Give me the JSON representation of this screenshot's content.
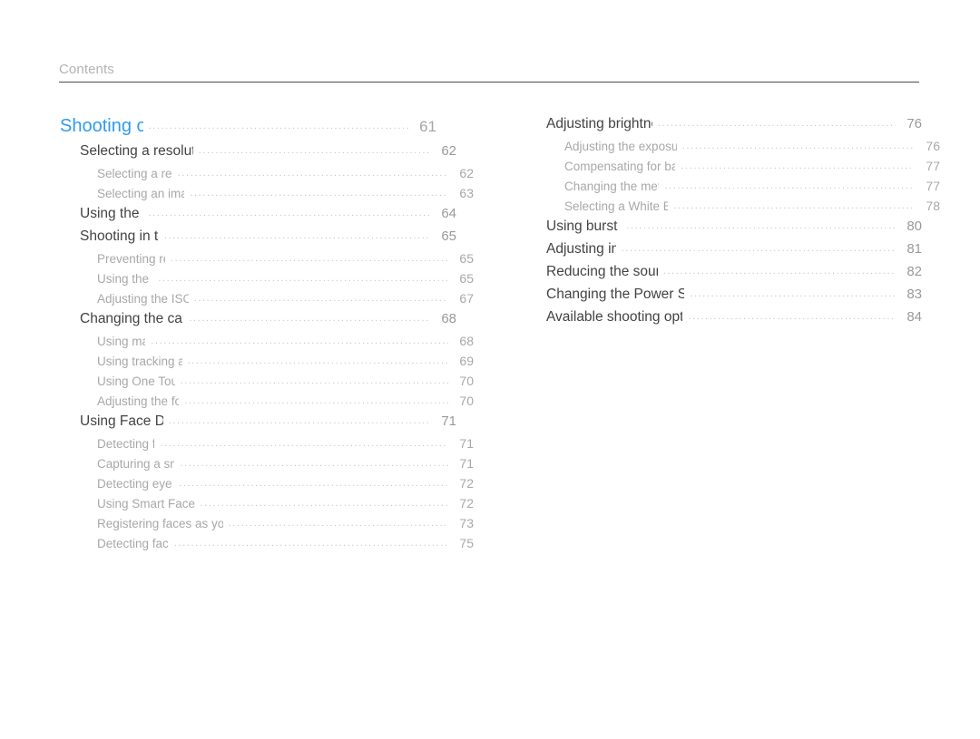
{
  "header": {
    "title": "Contents"
  },
  "colors": {
    "chapter_blue": "#2e9bef",
    "section_dark": "#434343",
    "subsection_gray": "#a8a8a8",
    "page_number_gray": "#a6a6a6",
    "header_gray": "#b3b3b3",
    "rule_dark": "#4d4d4d",
    "dots_gray": "#c6c6c6",
    "background": "#ffffff"
  },
  "dots": "....................................................................................................",
  "columns": {
    "left": {
      "entries": [
        {
          "level": 1,
          "label": "Shooting options",
          "page": "61"
        },
        {
          "level": 2,
          "label": "Selecting a resolution and quality",
          "page": "62"
        },
        {
          "level": 3,
          "label": "Selecting a resolution",
          "page": "62"
        },
        {
          "level": 3,
          "label": "Selecting an image quality",
          "page": "63"
        },
        {
          "level": 2,
          "label": "Using the timer",
          "page": "64"
        },
        {
          "level": 2,
          "label": "Shooting in the dark",
          "page": "65"
        },
        {
          "level": 3,
          "label": "Preventing red-eye",
          "page": "65"
        },
        {
          "level": 3,
          "label": "Using the flash",
          "page": "65"
        },
        {
          "level": 3,
          "label": "Adjusting the ISO sensitivity",
          "page": "67"
        },
        {
          "level": 2,
          "label": "Changing the camera’s focus",
          "page": "68"
        },
        {
          "level": 3,
          "label": "Using macro",
          "page": "68"
        },
        {
          "level": 3,
          "label": "Using tracking auto focus",
          "page": "69"
        },
        {
          "level": 3,
          "label": "Using One Touch Shot",
          "page": "70"
        },
        {
          "level": 3,
          "label": "Adjusting the focus area",
          "page": "70"
        },
        {
          "level": 2,
          "label": "Using Face Detection",
          "page": "71"
        },
        {
          "level": 3,
          "label": "Detecting faces",
          "page": "71"
        },
        {
          "level": 3,
          "label": "Capturing a smile shot",
          "page": "71"
        },
        {
          "level": 3,
          "label": "Detecting eye blinking",
          "page": "72"
        },
        {
          "level": 3,
          "label": "Using Smart Face Recognition",
          "page": "72"
        },
        {
          "level": 3,
          "label": "Registering faces as your favorites (My Star)",
          "page": "73"
        },
        {
          "level": 3,
          "label": "Detecting faces Tips",
          "page": "75"
        }
      ]
    },
    "right": {
      "entries": [
        {
          "level": 2,
          "label": "Adjusting brightness and color",
          "page": "76"
        },
        {
          "level": 3,
          "label": "Adjusting the exposure manually (EV)",
          "page": "76"
        },
        {
          "level": 3,
          "label": "Compensating for backlighting (ACB)",
          "page": "77"
        },
        {
          "level": 3,
          "label": "Changing the metering option",
          "page": "77"
        },
        {
          "level": 3,
          "label": "Selecting a White Balance setting",
          "page": "78"
        },
        {
          "level": 2,
          "label": "Using burst modes",
          "page": "80"
        },
        {
          "level": 2,
          "label": "Adjusting images",
          "page": "81"
        },
        {
          "level": 2,
          "label": "Reducing the sound of the zoom",
          "page": "82"
        },
        {
          "level": 2,
          "label": "Changing the Power Save Recording Options",
          "page": "83"
        },
        {
          "level": 2,
          "label": "Available shooting options by shooting mode",
          "page": "84"
        }
      ]
    }
  }
}
